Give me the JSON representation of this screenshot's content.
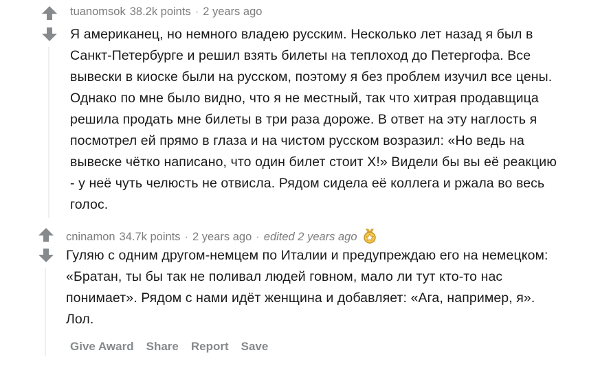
{
  "comments": [
    {
      "username": "tuanomsok",
      "points": "38.2k points",
      "time": "2 years ago",
      "lines": [
        "Я американец, но немного владею русским. Несколько лет назад я был в",
        "Санкт-Петербурге и решил взять билеты на теплоход до Петергофа. Все",
        "вывески в киоске были на русском, поэтому я без проблем изучил все цены.",
        "Однако по мне было видно, что я не местный, так что хитрая продавщица",
        "решила продать мне билеты в три раза дороже. В ответ на эту наглость я",
        "посмотрел ей прямо в глаза и на чистом русском возразил: «Но ведь на",
        "вывеске чётко написано, что один билет стоит Х!» Видели бы вы её реакцию",
        "- у неё чуть челюсть не отвисла. Рядом сидела её коллега и ржала во весь",
        "голос."
      ]
    },
    {
      "username": "cninamon",
      "points": "34.7k points",
      "time": "2 years ago",
      "edited": "edited 2 years ago",
      "award_icon": "award-medal-icon",
      "lines": [
        "Гуляю с одним другом-немцем по Италии и предупреждаю его на немецком:",
        "«Братан, ты бы так не поливал людей говном, мало ли тут кто-то нас",
        "понимает». Рядом с нами идёт женщина и добавляет: «Ага, например, я».",
        "Лол."
      ]
    }
  ],
  "actions": [
    "Give Award",
    "Share",
    "Report",
    "Save"
  ],
  "colors": {
    "meta": "#7c7c7c",
    "arrow": "#878a8c",
    "thread": "#edeff1",
    "action": "#878a8c"
  }
}
